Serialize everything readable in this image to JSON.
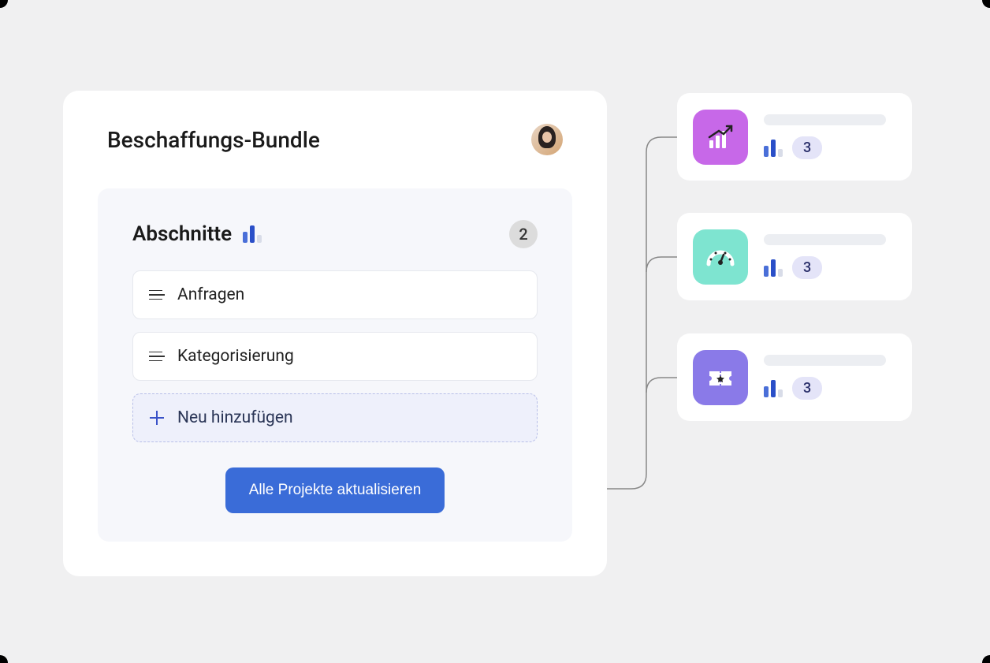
{
  "bundle": {
    "title": "Beschaffungs-Bundle"
  },
  "sections": {
    "heading": "Abschnitte",
    "count": "2",
    "items": [
      {
        "label": "Anfragen"
      },
      {
        "label": "Kategorisierung"
      }
    ],
    "add_label": "Neu hinzufügen"
  },
  "actions": {
    "update_all": "Alle Projekte aktualisieren"
  },
  "projects": [
    {
      "icon": "chart-growth-icon",
      "count": "3"
    },
    {
      "icon": "gauge-icon",
      "count": "3"
    },
    {
      "icon": "ticket-icon",
      "count": "3"
    }
  ]
}
